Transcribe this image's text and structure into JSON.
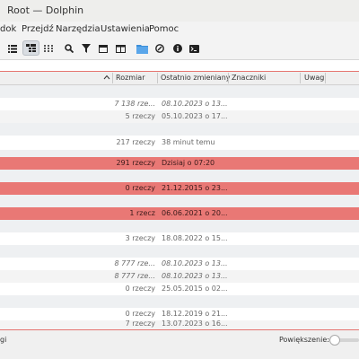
{
  "window": {
    "title": "Root — Dolphin"
  },
  "menu": {
    "items": [
      "dok",
      "Przejdź",
      "Narzędzia",
      "Ustawienia",
      "Pomoc"
    ]
  },
  "toolbar": {
    "buttons": [
      {
        "name": "list-view-icon"
      },
      {
        "name": "tree-view-icon",
        "active": true
      },
      {
        "name": "compact-view-icon"
      },
      {
        "name": "search-icon"
      },
      {
        "name": "filter-icon"
      },
      {
        "name": "terminal-panel-icon"
      },
      {
        "name": "split-view-icon"
      },
      {
        "name": "new-folder-icon"
      },
      {
        "name": "copy-location-icon"
      },
      {
        "name": "info-icon"
      },
      {
        "name": "open-terminal-icon"
      }
    ]
  },
  "columns": {
    "size": "Rozmiar",
    "modified": "Ostatnio zmieniany",
    "tags": "Znaczniki",
    "comment": "Uwagi"
  },
  "rows": [
    {
      "size": "",
      "modified": ""
    },
    {
      "size": "7 138 rze...",
      "modified": "08.10.2023 o 13...",
      "italic": true
    },
    {
      "size": "5 rzeczy",
      "modified": "05.10.2023 o 17..."
    },
    {
      "size": "",
      "modified": ""
    },
    {
      "size": "217 rzeczy",
      "modified": "38 minut temu"
    },
    {
      "size": "",
      "modified": ""
    },
    {
      "size": "291 rzeczy",
      "modified": "Dzisiaj o 07:20",
      "highlight": true
    },
    {
      "size": "",
      "modified": ""
    },
    {
      "size": "0 rzeczy",
      "modified": "21.12.2015 o 23...",
      "highlight": true
    },
    {
      "size": "",
      "modified": ""
    },
    {
      "size": "1 rzecz",
      "modified": "06.06.2021 o 20...",
      "highlight": true
    },
    {
      "size": "",
      "modified": ""
    },
    {
      "size": "3 rzeczy",
      "modified": "18.08.2022 o 15..."
    },
    {
      "size": "",
      "modified": ""
    },
    {
      "size": "8 777 rze...",
      "modified": "08.10.2023 o 13...",
      "italic": true
    },
    {
      "size": "8 777 rze...",
      "modified": "08.10.2023 o 13...",
      "italic": true
    },
    {
      "size": "0 rzeczy",
      "modified": "25.05.2015 o 02..."
    },
    {
      "size": "",
      "modified": ""
    },
    {
      "size": "0 rzeczy",
      "modified": "18.12.2019 o 21..."
    },
    {
      "size": "7 rzeczy",
      "modified": "13.07.2023 o 16..."
    }
  ],
  "status": {
    "left": "gi",
    "zoom_label": "Powiększenie:"
  },
  "colors": {
    "highlight": "#e97875",
    "accent_line": "#e5746f",
    "folder": "#3d8fd8"
  }
}
